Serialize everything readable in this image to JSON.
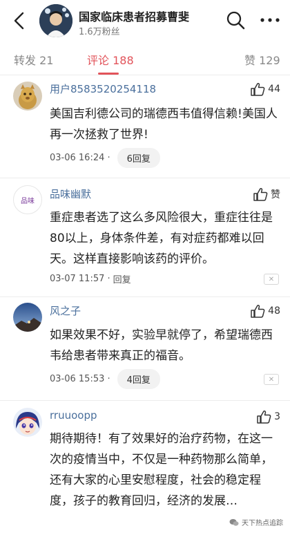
{
  "header": {
    "title": "国家临床患者招募曹斐",
    "subtitle": "1.6万粉丝"
  },
  "tabs": [
    {
      "label": "转发 21"
    },
    {
      "label": "评论 188"
    },
    {
      "label": "赞 129"
    }
  ],
  "comments": [
    {
      "user": "用户8583520254118",
      "likes": "44",
      "text": "美国吉利德公司的瑞德西韦值得信赖!美国人再一次拯救了世界!",
      "time": "03-06 16:24 ·",
      "reply": "6回复"
    },
    {
      "user": "品味幽默",
      "likes": "赞",
      "avatar_text": "品味",
      "text": "重症患者选了这么多风险很大，重症往往是80以上，身体条件差，有对症药都难以回天。这样直接影响该药的评价。",
      "time": "03-07 11:57 ·",
      "reply": "回复"
    },
    {
      "user": "风之子",
      "likes": "48",
      "text": "如果效果不好，实验早就停了，希望瑞德西韦给患者带来真正的福音。",
      "time": "03-06 15:53 ·",
      "reply": "4回复"
    },
    {
      "user": "rruuoopp",
      "likes": "3",
      "text": "期待期待！有了效果好的治疗药物，在这一次的疫情当中，不仅是一种药物那么简单，还有大家的心里安慰程度，社会的稳定程度，孩子的教育回归，经济的发展…"
    }
  ],
  "watermark": "天下热点追踪",
  "colors": {
    "accent": "#e2535a",
    "username": "#4a6f9c"
  }
}
